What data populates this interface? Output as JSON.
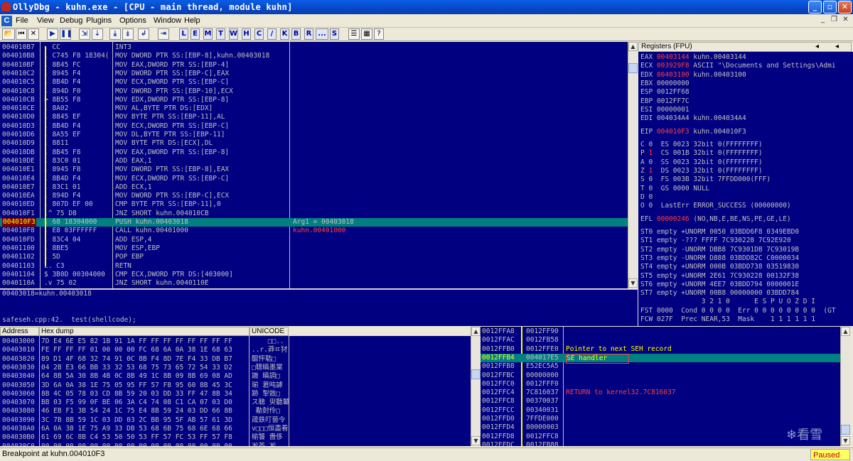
{
  "window": {
    "title": "OllyDbg - kuhn.exe - [CPU - main thread, module kuhn]"
  },
  "menu": [
    "File",
    "View",
    "Debug",
    "Plugins",
    "Options",
    "Window",
    "Help"
  ],
  "toolbar": {
    "letters": [
      "L",
      "E",
      "M",
      "T",
      "W",
      "H",
      "C",
      "/",
      "K",
      "B",
      "R",
      "...",
      "S"
    ]
  },
  "disasm": [
    {
      "addr": "004010B7",
      "mark": ".",
      "hex": "CC",
      "dis": "INT3",
      "cmt": ""
    },
    {
      "addr": "004010B8",
      "mark": ".",
      "hex": "C745 F8 18304(",
      "dis": "MOV DWORD PTR SS:[EBP-8],kuhn.00403018",
      "cmt": ""
    },
    {
      "addr": "004010BF",
      "mark": ".",
      "hex": "8B45 FC",
      "dis": "MOV EAX,DWORD PTR SS:[EBP-4]",
      "cmt": ""
    },
    {
      "addr": "004010C2",
      "mark": ".",
      "hex": "8945 F4",
      "dis": "MOV DWORD PTR SS:[EBP-C],EAX",
      "cmt": ""
    },
    {
      "addr": "004010C5",
      "mark": ".",
      "hex": "8B4D F4",
      "dis": "MOV ECX,DWORD PTR SS:[EBP-C]",
      "cmt": ""
    },
    {
      "addr": "004010C8",
      "mark": ".",
      "hex": "894D F0",
      "dis": "MOV DWORD PTR SS:[EBP-10],ECX",
      "cmt": ""
    },
    {
      "addr": "004010CB",
      "mark": ">",
      "hex": "8B55 F8",
      "dis": "MOV EDX,DWORD PTR SS:[EBP-8]",
      "cmt": ""
    },
    {
      "addr": "004010CE",
      "mark": ".",
      "hex": "8A02",
      "dis": "MOV AL,BYTE PTR DS:[EDX]",
      "cmt": ""
    },
    {
      "addr": "004010D0",
      "mark": ".",
      "hex": "8845 EF",
      "dis": "MOV BYTE PTR SS:[EBP-11],AL",
      "cmt": ""
    },
    {
      "addr": "004010D3",
      "mark": ".",
      "hex": "8B4D F4",
      "dis": "MOV ECX,DWORD PTR SS:[EBP-C]",
      "cmt": ""
    },
    {
      "addr": "004010D6",
      "mark": ".",
      "hex": "8A55 EF",
      "dis": "MOV DL,BYTE PTR SS:[EBP-11]",
      "cmt": ""
    },
    {
      "addr": "004010D9",
      "mark": ".",
      "hex": "8811",
      "dis": "MOV BYTE PTR DS:[ECX],DL",
      "cmt": ""
    },
    {
      "addr": "004010DB",
      "mark": ".",
      "hex": "8B45 F8",
      "dis": "MOV EAX,DWORD PTR SS:[EBP-8]",
      "cmt": ""
    },
    {
      "addr": "004010DE",
      "mark": ".",
      "hex": "83C0 01",
      "dis": "ADD EAX,1",
      "cmt": ""
    },
    {
      "addr": "004010E1",
      "mark": ".",
      "hex": "8945 F8",
      "dis": "MOV DWORD PTR SS:[EBP-8],EAX",
      "cmt": ""
    },
    {
      "addr": "004010E4",
      "mark": ".",
      "hex": "8B4D F4",
      "dis": "MOV ECX,DWORD PTR SS:[EBP-C]",
      "cmt": ""
    },
    {
      "addr": "004010E7",
      "mark": ".",
      "hex": "83C1 01",
      "dis": "ADD ECX,1",
      "cmt": ""
    },
    {
      "addr": "004010EA",
      "mark": ".",
      "hex": "894D F4",
      "dis": "MOV DWORD PTR SS:[EBP-C],ECX",
      "cmt": ""
    },
    {
      "addr": "004010ED",
      "mark": ".",
      "hex": "807D EF 00",
      "dis": "CMP BYTE PTR SS:[EBP-11],0",
      "cmt": ""
    },
    {
      "addr": "004010F1",
      "mark": ".^",
      "hex": "75 D8",
      "dis": "JNZ SHORT kuhn.004010CB",
      "cmt": ""
    },
    {
      "addr": "004010F3",
      "mark": ".",
      "hex": "68 18304000",
      "dis": "PUSH kuhn.00403018",
      "cmt": "Arg1 = 00403018",
      "sel": true
    },
    {
      "addr": "004010F8",
      "mark": ".",
      "hex": "E8 03FFFFFF",
      "dis": "CALL kuhn.00401000",
      "cmt": "kuhn.00401000",
      "cmtred": true
    },
    {
      "addr": "004010FD",
      "mark": ".",
      "hex": "83C4 04",
      "dis": "ADD ESP,4",
      "cmt": ""
    },
    {
      "addr": "00401100",
      "mark": ".",
      "hex": "8BE5",
      "dis": "MOV ESP,EBP",
      "cmt": ""
    },
    {
      "addr": "00401102",
      "mark": ".",
      "hex": "5D",
      "dis": "POP EBP",
      "cmt": ""
    },
    {
      "addr": "00401103",
      "mark": "L.",
      "hex": "C3",
      "dis": "RETN",
      "cmt": ""
    },
    {
      "addr": "00401104",
      "mark": "$",
      "hex": "3B0D 00304000",
      "dis": "CMP ECX,DWORD PTR DS:[403000]",
      "cmt": ""
    },
    {
      "addr": "0040110A",
      "mark": ".v",
      "hex": "75 02",
      "dis": "JNZ SHORT kuhn.0040110E",
      "cmt": ""
    }
  ],
  "info": {
    "line1": "00403018=kuhn.00403018",
    "line2": "safeseh.cpp:42.  test(shellcode);"
  },
  "registers": {
    "header": "Registers (FPU)",
    "gp": [
      {
        "n": "EAX",
        "v": "00403144",
        "c": "kuhn.00403144",
        "red": true
      },
      {
        "n": "ECX",
        "v": "003929F8",
        "c": "ASCII \"\\Documents and Settings\\Admi",
        "red": true
      },
      {
        "n": "EDX",
        "v": "00403100",
        "c": "kuhn.00403100",
        "red": true
      },
      {
        "n": "EBX",
        "v": "00000000",
        "c": ""
      },
      {
        "n": "ESP",
        "v": "0012FF68",
        "c": ""
      },
      {
        "n": "EBP",
        "v": "0012FF7C",
        "c": ""
      },
      {
        "n": "ESI",
        "v": "00000001",
        "c": ""
      },
      {
        "n": "EDI",
        "v": "004034A4",
        "c": "kuhn.004034A4"
      }
    ],
    "eip": {
      "n": "EIP",
      "v": "004010F3",
      "c": "kuhn.004010F3"
    },
    "flags": [
      {
        "f": "C",
        "v": "0",
        "seg": "ES 0023 32bit 0(FFFFFFFF)"
      },
      {
        "f": "P",
        "v": "1",
        "red": true,
        "seg": "CS 001B 32bit 0(FFFFFFFF)"
      },
      {
        "f": "A",
        "v": "0",
        "seg": "SS 0023 32bit 0(FFFFFFFF)"
      },
      {
        "f": "Z",
        "v": "1",
        "red": true,
        "seg": "DS 0023 32bit 0(FFFFFFFF)"
      },
      {
        "f": "S",
        "v": "0",
        "seg": "FS 003B 32bit 7FFDD000(FFF)"
      },
      {
        "f": "T",
        "v": "0",
        "seg": "GS 0000 NULL"
      },
      {
        "f": "D",
        "v": "0",
        "seg": ""
      },
      {
        "f": "O",
        "v": "0",
        "seg": "LastErr ERROR_SUCCESS (00000000)"
      }
    ],
    "efl": {
      "n": "EFL",
      "v": "00000246",
      "c": "(NO,NB,E,BE,NS,PE,GE,LE)"
    },
    "fpu": [
      "ST0 empty +UNORM 0050 03BDD6F8 0349EBD0",
      "ST1 empty -??? FFFF 7C930228 7C92E920",
      "ST2 empty -UNORM DBB8 7C9301DB 7C93019B",
      "ST3 empty -UNORM D888 03BDD82C C0000034",
      "ST4 empty +UNORM 000B 03BDD738 03519830",
      "ST5 empty +UNORM 2E61 7C930228 00132F38",
      "ST6 empty +UNORM 4EE7 03BDD794 0000001E",
      "ST7 empty +UNORM 00B8 00000000 03BDD784"
    ],
    "fpu_tail": [
      "               3 2 1 0      E S P U O Z D I",
      "FST 0000  Cond 0 0 0 0  Err 0 0 0 0 0 0 0 0  (GT",
      "FCW 027F  Prec NEAR,53  Mask    1 1 1 1 1 1"
    ]
  },
  "dump": {
    "headers": [
      "Address",
      "Hex dump",
      "UNICODE"
    ],
    "rows": [
      {
        "a": "00403000",
        "h": "7D E4 6E E5 82 1B 91 1A FF FF FF FF FF FF FF FF",
        "u": "    □□.."
      },
      {
        "a": "00403010",
        "h": "FE FF FF FF 01 00 00 00 FC 68 6A 0A 38 1E 68 63",
        "u": "..r.莽ㄸ犲"
      },
      {
        "a": "00403020",
        "h": "89 D1 4F 68 32 74 91 0C 8B F4 8D 7E F4 33 DB B7",
        "u": "醌怦聐□"
      },
      {
        "a": "00403030",
        "h": "04 2B E3 66 BB 33 32 53 68 75 73 65 72 54 33 D2",
        "u": "□聰瞋墨棠"
      },
      {
        "a": "00403040",
        "h": "64 8B 5A 30 8B 4B 0C 8B 49 1C 8B 09 8B 69 08 AD",
        "u": "譈 瞋調□"
      },
      {
        "a": "00403050",
        "h": "3D 6A 0A 38 1E 75 05 95 FF 57 F8 95 60 8B 45 3C",
        "u": "瑐 莙吨謼"
      },
      {
        "a": "00403060",
        "h": "8B 4C 05 78 03 CD 8B 59 20 03 DD 33 FF 47 8B 34",
        "u": "跡 掣敓□"
      },
      {
        "a": "00403070",
        "h": "BB 03 F5 99 0F BE 06 3A C4 74 08 C1 CA 07 03 D0",
        "u": "ス聴 臾聽鼙"
      },
      {
        "a": "00403080",
        "h": "46 EB F1 3B 54 24 1C 75 E4 8B 59 24 03 DD 66 8B",
        "u": " 勈尌伶□"
      },
      {
        "a": "00403090",
        "h": "3C 7B 8B 59 1C 03 DD 03 2C BB 95 5F AB 57 61 3D",
        "u": "荿鉄叮兿令"
      },
      {
        "a": "004030A0",
        "h": "6A 0A 38 1E 75 A9 33 DB 53 68 6B 75 68 6E 68 66",
        "u": "ν□□□恒盡看"
      },
      {
        "a": "004030B0",
        "h": "61 69 6C 8B C4 53 50 50 53 FF 57 FC 53 FF 57 F8",
        "u": "榆饕 嗇侈"
      },
      {
        "a": "004030C0",
        "h": "00 00 00 00 00 00 00 00 00 00 00 00 00 00 00 00",
        "u": "凇茶 凇"
      }
    ]
  },
  "stack": [
    {
      "a": "0012FFA8",
      "v": "0012FF90",
      "c": ""
    },
    {
      "a": "0012FFAC",
      "v": "0012FB58",
      "c": ""
    },
    {
      "a": "0012FFB0",
      "v": "0012FFE0",
      "c": "Pointer to next SEH record",
      "yel": true
    },
    {
      "a": "0012FFB4",
      "v": "004017E5",
      "c": "SE handler",
      "yel": true,
      "sel": true
    },
    {
      "a": "0012FFB8",
      "v": "E52EC5A5",
      "c": ""
    },
    {
      "a": "0012FFBC",
      "v": "00000000",
      "c": ""
    },
    {
      "a": "0012FFC0",
      "v": "0012FFF0",
      "c": ""
    },
    {
      "a": "0012FFC4",
      "v": "7C816037",
      "c": "RETURN to kernel32.7C816037",
      "red": true
    },
    {
      "a": "0012FFC8",
      "v": "00370037",
      "c": ""
    },
    {
      "a": "0012FFCC",
      "v": "00340031",
      "c": ""
    },
    {
      "a": "0012FFD0",
      "v": "7FFDE000",
      "c": ""
    },
    {
      "a": "0012FFD4",
      "v": "80000003",
      "c": ""
    },
    {
      "a": "0012FFD8",
      "v": "0012FFC8",
      "c": ""
    },
    {
      "a": "0012FFDC",
      "v": "0012FB88",
      "c": ""
    }
  ],
  "status": {
    "message": "Breakpoint at kuhn.004010F3",
    "state": "Paused"
  },
  "watermark": "看雪",
  "colors": {
    "pane_bg": "#000080",
    "selection": "#008080",
    "highlight_red": "#ff4040",
    "yellow": "#ffff00"
  }
}
